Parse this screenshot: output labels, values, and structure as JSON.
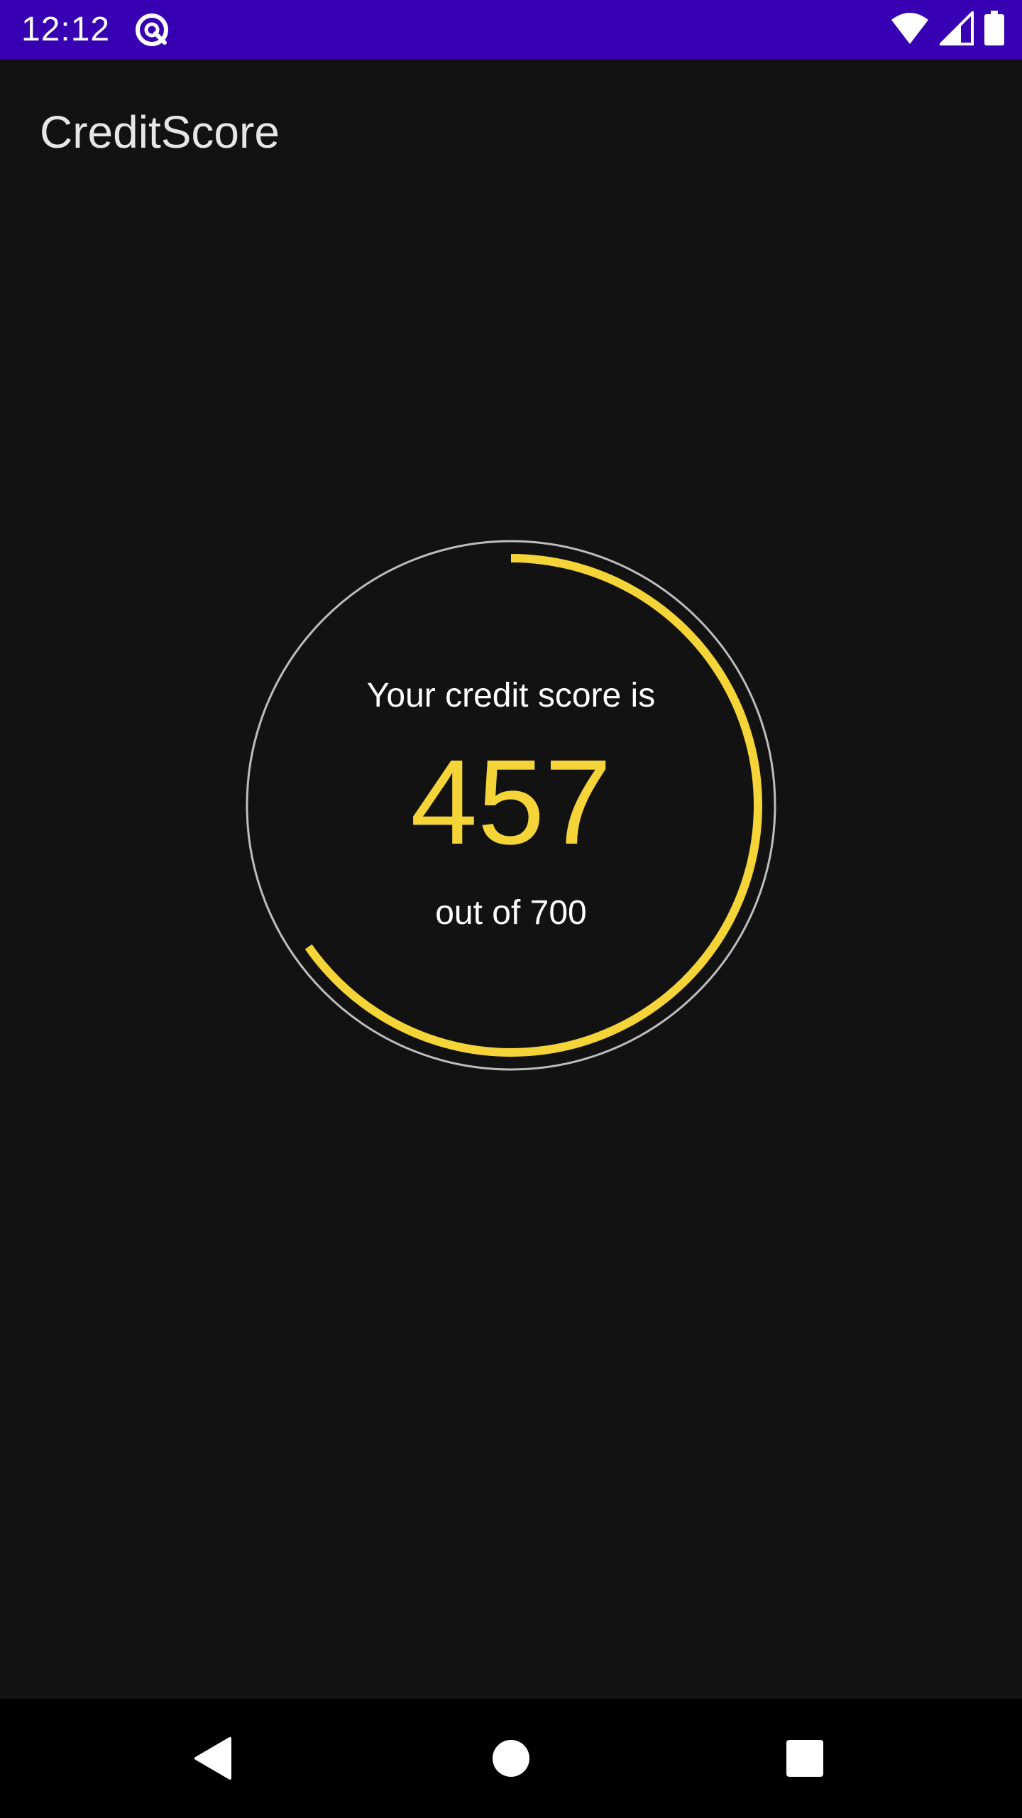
{
  "status_bar": {
    "time": "12:12",
    "background": "#3700b3",
    "icons": [
      "app-notification-icon",
      "wifi-icon",
      "cellular-signal-icon",
      "battery-icon"
    ]
  },
  "app_bar": {
    "title": "CreditScore"
  },
  "credit_score": {
    "label": "Your credit score is",
    "score": "457",
    "max_text": "out of 700",
    "score_value": 457,
    "max_value": 700,
    "progress_fraction": 0.653,
    "accent_color": "#f5d437",
    "ring_color": "#bdbdbd"
  },
  "navigation_bar": {
    "buttons": [
      "back-icon",
      "home-icon",
      "recents-icon"
    ]
  }
}
